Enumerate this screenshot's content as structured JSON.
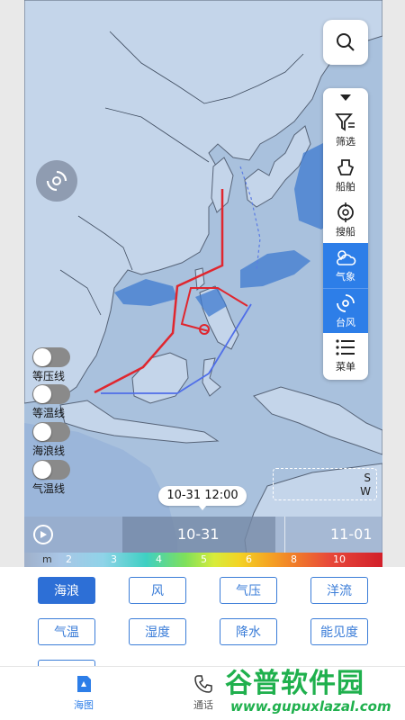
{
  "toolbar": {
    "search_icon": "search-icon",
    "items": [
      {
        "label": "筛选",
        "icon": "filter-icon",
        "active": false
      },
      {
        "label": "船舶",
        "icon": "ship-icon",
        "active": false
      },
      {
        "label": "搜船",
        "icon": "crosshair-icon",
        "active": false
      },
      {
        "label": "气象",
        "icon": "weather-icon",
        "active": true
      },
      {
        "label": "台风",
        "icon": "typhoon-icon",
        "active": true
      },
      {
        "label": "菜单",
        "icon": "menu-icon",
        "active": false
      }
    ]
  },
  "layers": [
    {
      "label": "等压线",
      "on": false
    },
    {
      "label": "等温线",
      "on": false
    },
    {
      "label": "海浪线",
      "on": false
    },
    {
      "label": "气温线",
      "on": false
    }
  ],
  "map": {
    "legend_s": "S",
    "legend_w": "W",
    "time_bubble": "10-31 12:00"
  },
  "timeline": {
    "current_date": "10-31",
    "next_date": "11-01"
  },
  "scale": {
    "unit": "m",
    "ticks": [
      "2",
      "3",
      "4",
      "5",
      "6",
      "8",
      "10"
    ]
  },
  "options": [
    "海浪",
    "风",
    "气压",
    "洋流",
    "气温",
    "湿度",
    "降水",
    "能见度"
  ],
  "selected_option": "海浪",
  "nav": [
    {
      "label": "海图",
      "active": true
    },
    {
      "label": "通话",
      "active": false
    }
  ],
  "watermark": {
    "title": "谷普软件园",
    "url": "www.gupuxlazal.com"
  },
  "colors": {
    "accent": "#2d7ee8",
    "route_red": "#e0262e",
    "route_blue": "#4f6ee8",
    "sea": "#a9c1dd",
    "land": "#c4d5ea"
  }
}
